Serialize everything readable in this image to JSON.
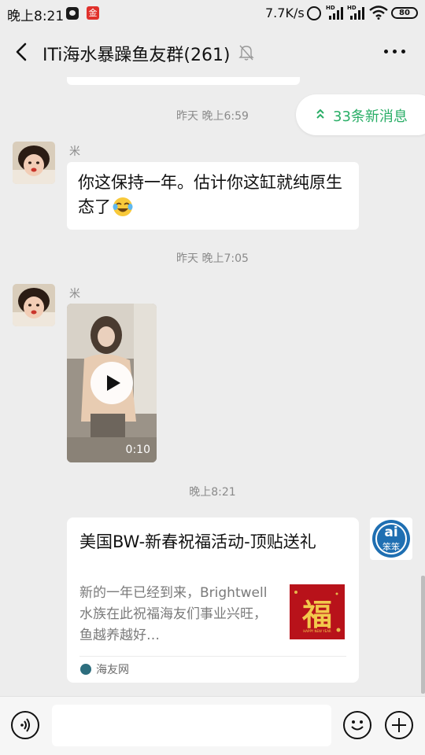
{
  "status_bar": {
    "time": "晚上8:21",
    "app_badge": "金",
    "net_speed": "7.7K/s",
    "signal_label": "HD",
    "battery": "80"
  },
  "header": {
    "title": "ITi海水暴躁鱼友群(261)"
  },
  "chat": {
    "new_messages": "33条新消息",
    "timestamps": [
      "昨天 晚上6:59",
      "昨天 晚上7:05",
      "晚上8:21"
    ],
    "messages": [
      {
        "sender": "米",
        "text": "你这保持一年。估计你这缸就纯原生态了"
      },
      {
        "sender": "米",
        "video_duration": "0:10"
      }
    ],
    "card": {
      "title": "美国BW-新春祝福活动-顶贴送礼",
      "description": "新的一年已经到来，Brightwell水族在此祝福海友们事业兴旺，鱼越养越好…",
      "thumb_char": "福",
      "thumb_caption": "HAPPY NEW YEAR",
      "source": "海友网",
      "avatar_text": "ai",
      "avatar_sub": "笨笨"
    }
  },
  "input": {
    "value": ""
  }
}
